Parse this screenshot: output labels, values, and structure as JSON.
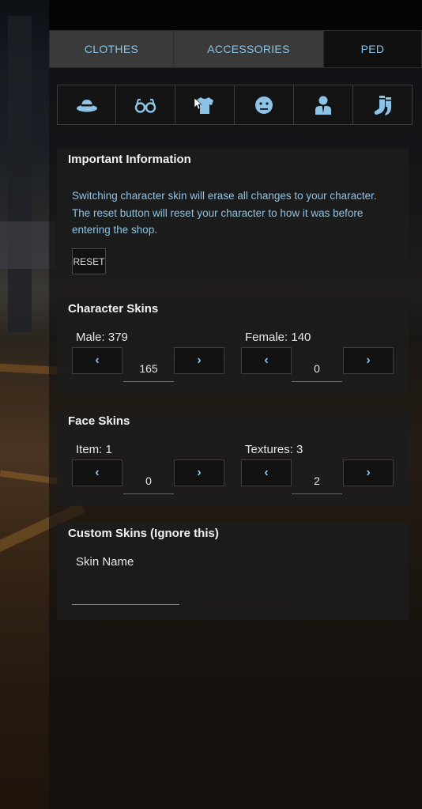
{
  "tabs": [
    {
      "label": "CLOTHES"
    },
    {
      "label": "ACCESSORIES"
    },
    {
      "label": "PED"
    }
  ],
  "category_icons": [
    "hat-icon",
    "glasses-icon",
    "shirt-icon",
    "face-icon",
    "ped-icon",
    "socks-icon"
  ],
  "accent_color": "#8cc3e6",
  "info": {
    "title": "Important Information",
    "text": "Switching character skin will erase all changes to your character. The reset button will reset your character to how it was before entering the shop.",
    "reset_label": "RESET"
  },
  "character_skins": {
    "title": "Character Skins",
    "male_label": "Male: 379",
    "male_value": "165",
    "female_label": "Female: 140",
    "female_value": "0"
  },
  "face_skins": {
    "title": "Face Skins",
    "item_label": "Item: 1",
    "item_value": "0",
    "textures_label": "Textures: 3",
    "textures_value": "2"
  },
  "custom_skins": {
    "title": "Custom Skins (Ignore this)",
    "name_label": "Skin Name",
    "name_value": ""
  },
  "arrows": {
    "left": "‹",
    "right": "›"
  }
}
